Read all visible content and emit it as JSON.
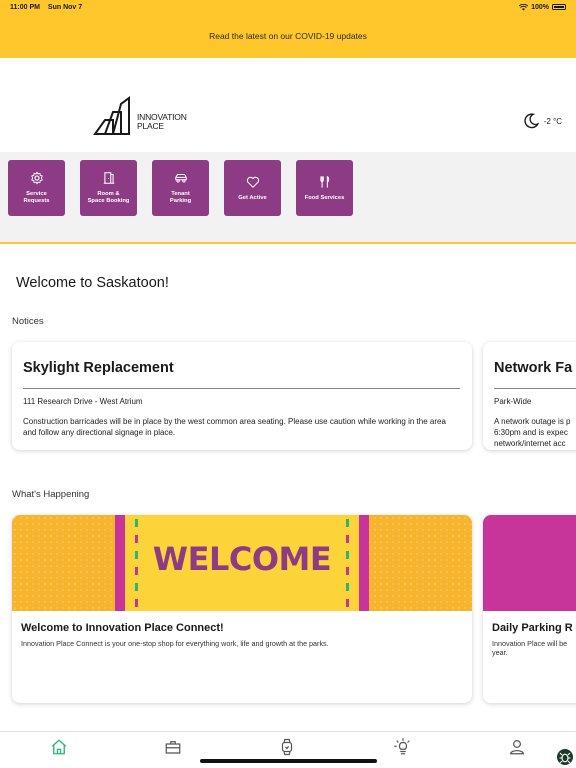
{
  "status_bar": {
    "time": "11:00 PM",
    "date": "Sun Nov 7",
    "battery": "100%"
  },
  "banner": {
    "text": "Read the latest on our COVID-19 updates"
  },
  "header": {
    "logo_line1": "INNOVATION",
    "logo_line2": "PLACE",
    "temperature": "-2 °C",
    "weather_icon": "moon-icon"
  },
  "quick_links": [
    {
      "label": "Service\nRequests",
      "icon": "gear-icon"
    },
    {
      "label": "Room &\nSpace Booking",
      "icon": "door-icon"
    },
    {
      "label": "Tenant\nParking",
      "icon": "car-icon"
    },
    {
      "label": "Get Active",
      "icon": "heart-icon"
    },
    {
      "label": "Food Services",
      "icon": "utensils-icon"
    }
  ],
  "welcome": "Welcome to Saskatoon!",
  "notices": {
    "heading": "Notices",
    "items": [
      {
        "title": "Skylight Replacement",
        "location": "111 Research Drive - West Atrium",
        "body": "Construction barricades will be in place by the west common area seating. Please use caution while working in the area and follow any directional signage in place."
      },
      {
        "title": "Network Fa",
        "location": "Park-Wide",
        "body": "A network outage is p\n6:30pm and is expec\nnetwork/internet acc"
      }
    ]
  },
  "happening": {
    "heading": "What's Happening",
    "items": [
      {
        "image_text": "WELCOME",
        "title": "Welcome to Innovation Place Connect!",
        "body": "Innovation Place Connect is your one-stop shop for everything work, life and growth at the parks."
      },
      {
        "title": "Daily Parking R",
        "body": "Innovation Place will be\nyear."
      }
    ]
  },
  "tabbar": {
    "tabs": [
      {
        "icon": "home-icon",
        "active": true
      },
      {
        "icon": "briefcase-icon",
        "active": false
      },
      {
        "icon": "watch-icon",
        "active": false
      },
      {
        "icon": "lightbulb-icon",
        "active": false
      },
      {
        "icon": "user-icon",
        "active": false
      }
    ]
  },
  "colors": {
    "brand_yellow": "#ffc72c",
    "brand_purple": "#8e3b86",
    "active_tab": "#2bb673",
    "event_magenta": "#c7359a"
  }
}
